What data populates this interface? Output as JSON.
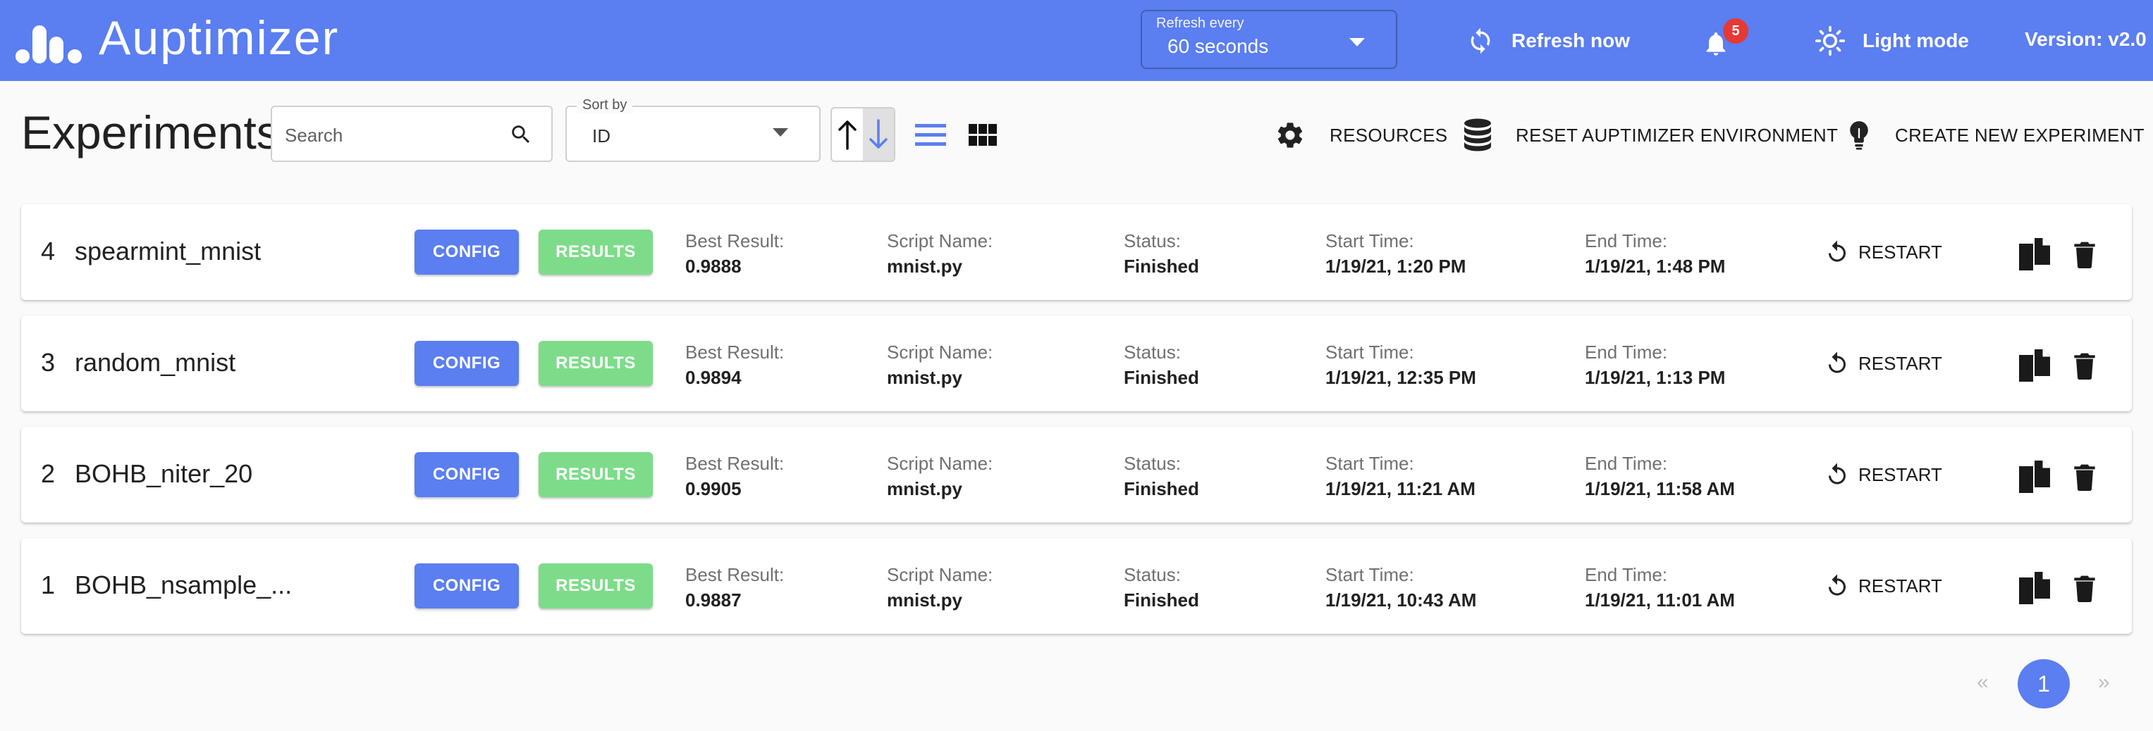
{
  "header": {
    "brand": "Auptimizer",
    "refresh_label": "Refresh every",
    "refresh_value": "60 seconds",
    "refresh_now": "Refresh now",
    "notification_count": "5",
    "light_mode": "Light mode",
    "version": "Version: v2.0"
  },
  "toolbar": {
    "title": "Experiments",
    "search_placeholder": "Search",
    "sort_label": "Sort by",
    "sort_value": "ID",
    "resources": "RESOURCES",
    "reset": "RESET AUPTIMIZER ENVIRONMENT",
    "create": "CREATE NEW EXPERIMENT"
  },
  "labels": {
    "config": "CONFIG",
    "results": "RESULTS",
    "best": "Best Result:",
    "script": "Script Name:",
    "status": "Status:",
    "start": "Start Time:",
    "end": "End Time:",
    "restart": "RESTART"
  },
  "experiments": [
    {
      "id": "4",
      "name": "spearmint_mnist",
      "best": "0.9888",
      "script": "mnist.py",
      "status": "Finished",
      "start": "1/19/21, 1:20 PM",
      "end": "1/19/21, 1:48 PM"
    },
    {
      "id": "3",
      "name": "random_mnist",
      "best": "0.9894",
      "script": "mnist.py",
      "status": "Finished",
      "start": "1/19/21, 12:35 PM",
      "end": "1/19/21, 1:13 PM"
    },
    {
      "id": "2",
      "name": "BOHB_niter_20",
      "best": "0.9905",
      "script": "mnist.py",
      "status": "Finished",
      "start": "1/19/21, 11:21 AM",
      "end": "1/19/21, 11:58 AM"
    },
    {
      "id": "1",
      "name": "BOHB_nsample_...",
      "best": "0.9887",
      "script": "mnist.py",
      "status": "Finished",
      "start": "1/19/21, 10:43 AM",
      "end": "1/19/21, 11:01 AM"
    }
  ],
  "pagination": {
    "prev": "«",
    "page": "1",
    "next": "»"
  },
  "colors": {
    "primary": "#5b7ef0",
    "results_green": "#7ddc8a",
    "badge_red": "#e53935"
  }
}
